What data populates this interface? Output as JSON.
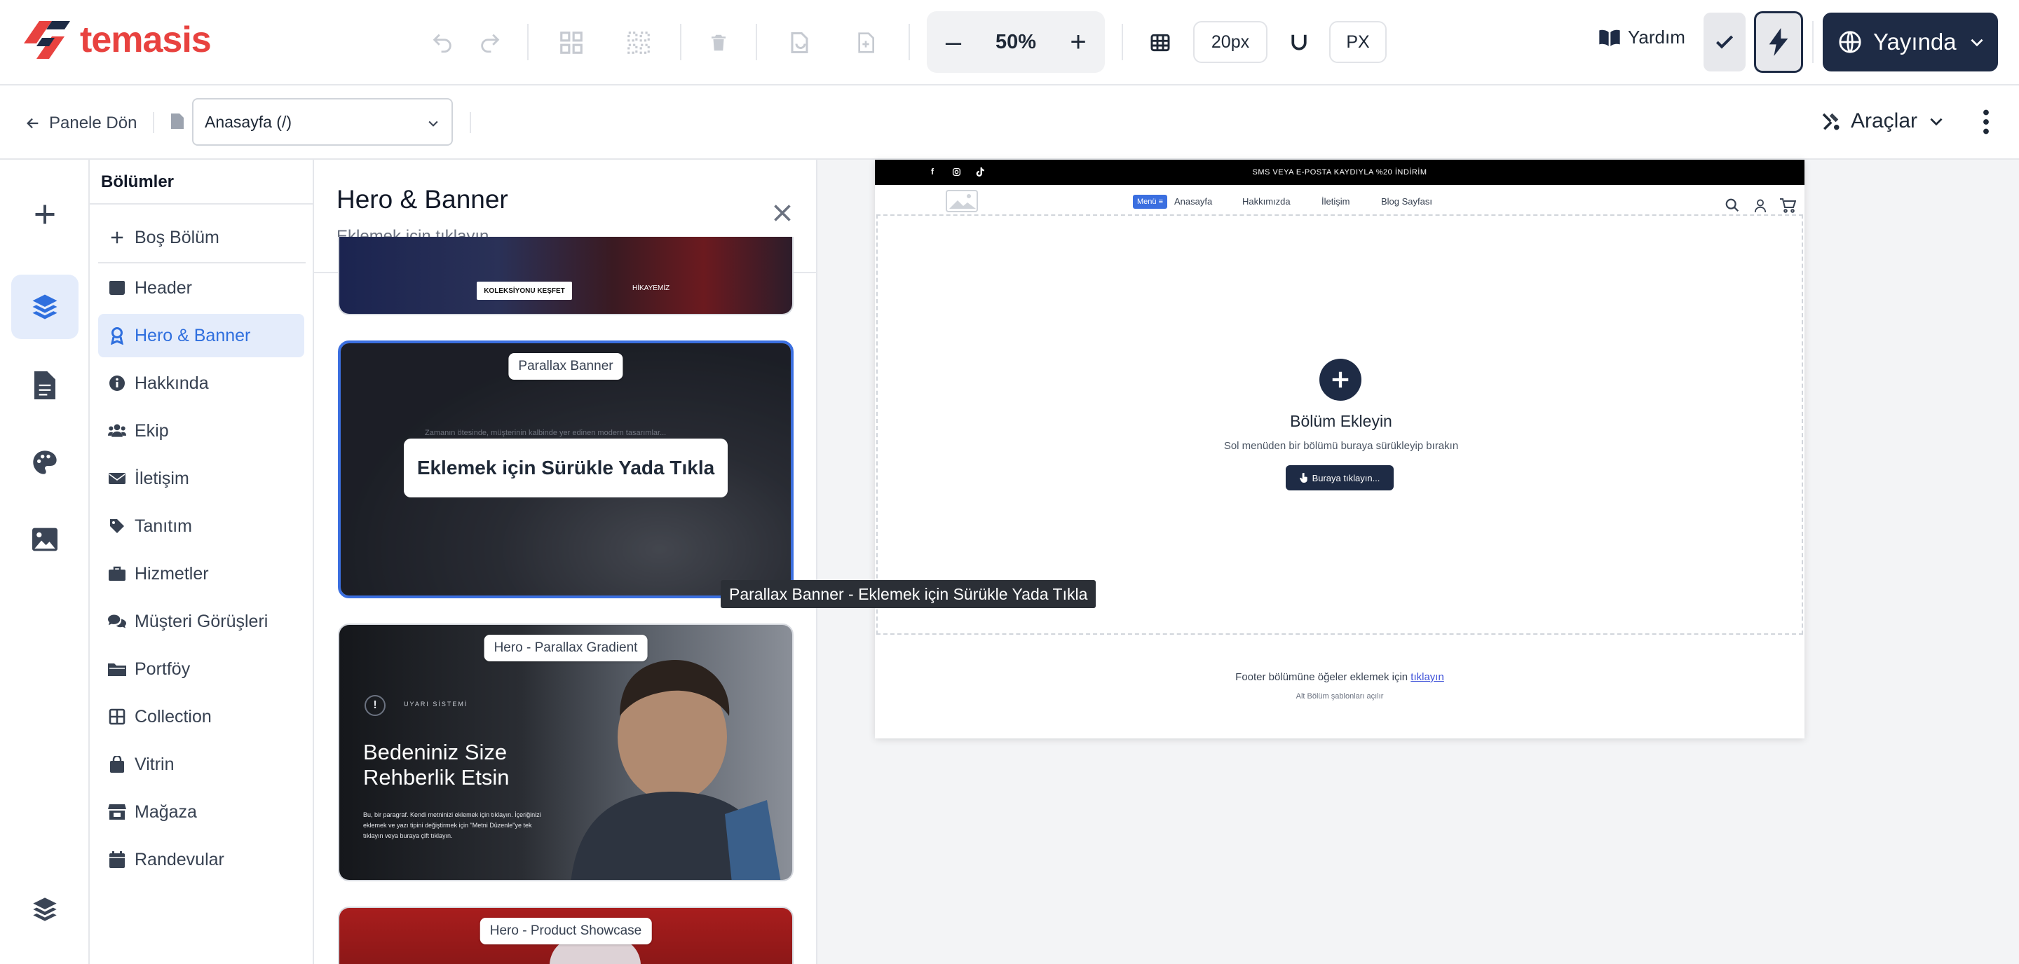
{
  "brand": {
    "name": "temasis",
    "accent": "#e8423f"
  },
  "toolbar": {
    "zoom": "50%",
    "grid_size": "20px",
    "unit": "PX",
    "help_label": "Yardım",
    "publish_label": "Yayında",
    "dark": "#1e2b45"
  },
  "subbar": {
    "back_label": "Panele Dön",
    "page_select": "Anasayfa (/)",
    "tools_label": "Araçlar"
  },
  "sections": {
    "title": "Bölümler",
    "items": [
      {
        "label": "Boş Bölüm",
        "icon": "plus-icon"
      },
      {
        "label": "Header",
        "icon": "header-icon"
      },
      {
        "label": "Hero & Banner",
        "icon": "hero-icon",
        "active": true
      },
      {
        "label": "Hakkında",
        "icon": "info-icon"
      },
      {
        "label": "Ekip",
        "icon": "team-icon"
      },
      {
        "label": "İletişim",
        "icon": "envelope-icon"
      },
      {
        "label": "Tanıtım",
        "icon": "tag-icon"
      },
      {
        "label": "Hizmetler",
        "icon": "briefcase-icon"
      },
      {
        "label": "Müşteri Görüşleri",
        "icon": "comments-icon"
      },
      {
        "label": "Portföy",
        "icon": "folder-icon"
      },
      {
        "label": "Collection",
        "icon": "table-icon"
      },
      {
        "label": "Vitrin",
        "icon": "bag-icon"
      },
      {
        "label": "Mağaza",
        "icon": "store-icon"
      },
      {
        "label": "Randevular",
        "icon": "calendar-icon"
      }
    ]
  },
  "templates": {
    "title": "Hero & Banner",
    "subtitle": "Eklemek için tıklayın",
    "cards": [
      {
        "label": "",
        "top_texts": [
          "KOLEKSİYONU KEŞFET",
          "HİKAYEMİZ"
        ]
      },
      {
        "label": "Parallax Banner",
        "cta": "Eklemek için Sürükle Yada Tıkla",
        "faint_text": "Zamanın ötesinde, müşterinin kalbinde yer edinen modern tasarımlar..."
      },
      {
        "label": "Hero - Parallax Gradient",
        "eyebrow": "UYARI SİSTEMİ",
        "heading_line1": "Bedeniniz Size",
        "heading_line2": "Rehberlik Etsin",
        "body": "Bu, bir paragraf. Kendi metninizi eklemek için tıklayın. İçeriğinizi eklemek ve yazı tipini değiştirmek için \"Metni Düzenle\"ye tek tıklayın veya buraya çift tıklayın."
      },
      {
        "label": "Hero - Product Showcase"
      }
    ]
  },
  "tooltip": "Parallax Banner - Eklemek için Sürükle Yada Tıkla",
  "preview": {
    "announcement": "SMS VEYA E-POSTA KAYDIYLA %20 İNDİRİM",
    "menu_badge": "Menü ≡",
    "nav": [
      "Anasayfa",
      "Hakkımızda",
      "İletişim",
      "Blog Sayfası"
    ],
    "empty_title": "Bölüm Ekleyin",
    "empty_sub": "Sol menüden bir bölümü buraya sürükleyip bırakın",
    "click_here": "Buraya tıklayın...",
    "footer_text": "Footer bölümüne öğeler eklemek için",
    "footer_link": "tıklayın",
    "footer_sub": "Alt Bölüm şablonları açılır"
  }
}
